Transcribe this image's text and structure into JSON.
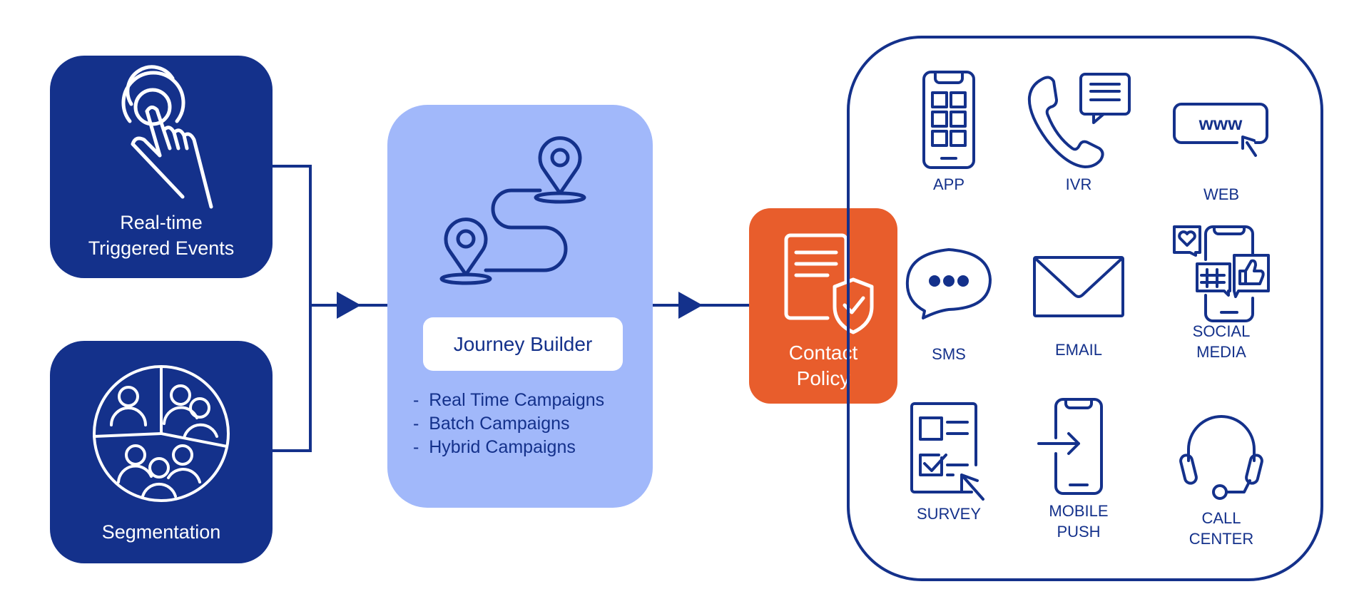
{
  "diagram": {
    "colors": {
      "dark_blue": "#14318B",
      "light_blue": "#A1B8FA",
      "orange": "#E85D2C",
      "white": "#FFFFFF"
    },
    "inputs": [
      {
        "label_lines": [
          "Real-time",
          "Triggered Events"
        ],
        "icon": "touch-tap-icon"
      },
      {
        "label_lines": [
          "Segmentation"
        ],
        "icon": "audience-segments-pie-icon"
      }
    ],
    "journey_builder": {
      "title": "Journey Builder",
      "icon": "journey-route-pins-icon",
      "bullets": [
        "-  Real Time Campaigns",
        "-  Batch Campaigns",
        "-  Hybrid Campaigns"
      ]
    },
    "contact_policy": {
      "label_lines": [
        "Contact",
        "Policy"
      ],
      "icon": "document-shield-check-icon"
    },
    "channels": [
      {
        "label_lines": [
          "APP"
        ],
        "icon": "mobile-app-grid-icon"
      },
      {
        "label_lines": [
          "IVR"
        ],
        "icon": "phone-chat-icon"
      },
      {
        "label_lines": [
          "WEB"
        ],
        "icon": "www-cursor-icon"
      },
      {
        "label_lines": [
          "SMS"
        ],
        "icon": "speech-bubble-dots-icon"
      },
      {
        "label_lines": [
          "EMAIL"
        ],
        "icon": "envelope-icon"
      },
      {
        "label_lines": [
          "SOCIAL",
          "MEDIA"
        ],
        "icon": "social-phone-icon"
      },
      {
        "label_lines": [
          "SURVEY"
        ],
        "icon": "survey-checklist-icon"
      },
      {
        "label_lines": [
          "MOBILE",
          "PUSH"
        ],
        "icon": "mobile-push-arrow-icon"
      },
      {
        "label_lines": [
          "CALL",
          "CENTER"
        ],
        "icon": "headset-icon"
      }
    ]
  }
}
